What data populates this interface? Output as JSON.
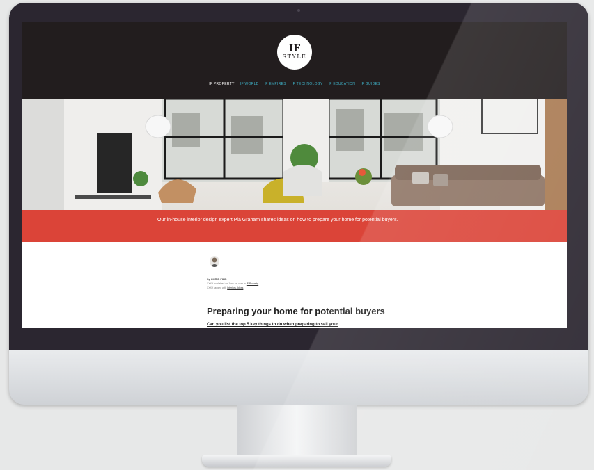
{
  "site": {
    "logo": {
      "top": "IF",
      "bottom": "STYLE"
    }
  },
  "nav": {
    "items": [
      {
        "label": "IF PROPERTY",
        "active": true
      },
      {
        "label": "IF WORLD"
      },
      {
        "label": "IF EMPIRES"
      },
      {
        "label": "IF TECHNOLOGY"
      },
      {
        "label": "IF EDUCATION"
      },
      {
        "label": "IF GUIDES"
      }
    ]
  },
  "colors": {
    "header": "#221d1e",
    "nav_accent": "#3fb3c9",
    "banner": "#db4438"
  },
  "banner": {
    "text": "Our in-house interior design expert Pia Graham shares ideas on how to prepare your home for potential buyers."
  },
  "article": {
    "byline_prefix": "By",
    "author": "CHRIS FIHS",
    "meta_line1": "XXXX published on June xx, xxxx in",
    "meta_line1_link": "IF Property",
    "meta_line2": "XXXX tagged with",
    "meta_line2_link": "Interiors, Ideas",
    "title": "Preparing your home for potential buyers",
    "lead": "Can you list the top 5 key things to do when preparing to sell your"
  }
}
